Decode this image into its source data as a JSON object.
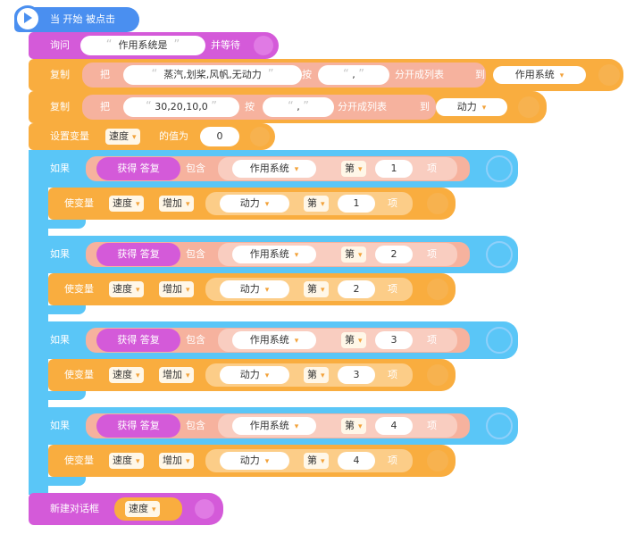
{
  "hat": {
    "label": "当 开始 被点击"
  },
  "ask": {
    "label": "询问",
    "value": "作用系统是",
    "suffix": "并等待"
  },
  "split1": {
    "label": "复制",
    "ba": "把",
    "text": "蒸汽,划桨,风帆,无动力",
    "an": "按",
    "sep": ",",
    "op": "分开成列表",
    "dao": "到",
    "list": "作用系统"
  },
  "split2": {
    "label": "复制",
    "ba": "把",
    "text": "30,20,10,0",
    "an": "按",
    "sep": ",",
    "op": "分开成列表",
    "dao": "到",
    "list": "动力"
  },
  "setvar": {
    "label": "设置变量",
    "var": "速度",
    "mid": "的值为",
    "value": "0"
  },
  "ifs": [
    {
      "if": "如果",
      "answer": "获得 答复",
      "contains": "包含",
      "list": "作用系统",
      "di": "第",
      "index": "1",
      "xiang": "项",
      "change": {
        "label": "使变量",
        "var": "速度",
        "op": "增加",
        "list": "动力",
        "di": "第",
        "index": "1",
        "xiang": "项"
      }
    },
    {
      "if": "如果",
      "answer": "获得 答复",
      "contains": "包含",
      "list": "作用系统",
      "di": "第",
      "index": "2",
      "xiang": "项",
      "change": {
        "label": "使变量",
        "var": "速度",
        "op": "增加",
        "list": "动力",
        "di": "第",
        "index": "2",
        "xiang": "项"
      }
    },
    {
      "if": "如果",
      "answer": "获得 答复",
      "contains": "包含",
      "list": "作用系统",
      "di": "第",
      "index": "3",
      "xiang": "项",
      "change": {
        "label": "使变量",
        "var": "速度",
        "op": "增加",
        "list": "动力",
        "di": "第",
        "index": "3",
        "xiang": "项"
      }
    },
    {
      "if": "如果",
      "answer": "获得 答复",
      "contains": "包含",
      "list": "作用系统",
      "di": "第",
      "index": "4",
      "xiang": "项",
      "change": {
        "label": "使变量",
        "var": "速度",
        "op": "增加",
        "list": "动力",
        "di": "第",
        "index": "4",
        "xiang": "项"
      }
    }
  ],
  "dialog": {
    "label": "新建对话框",
    "var": "速度"
  },
  "colors": {
    "hat": "#4a8ff0",
    "pink": "#d45ad9",
    "orange": "#f9ad3f",
    "blue": "#5ac6f7"
  }
}
